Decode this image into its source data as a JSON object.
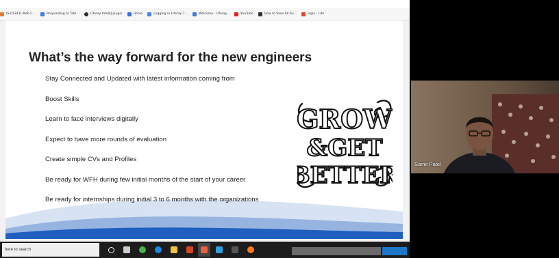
{
  "browser": {
    "bookmarks": [
      {
        "label": "IS-01343) Web C...",
        "color": "#e07b39"
      },
      {
        "label": "Responding to Tabl...",
        "color": "#3d7be0"
      },
      {
        "label": "Liferay IntelliJ plugin",
        "color": "#2b2b2b"
      },
      {
        "label": "Home",
        "color": "#3a6fd8"
      },
      {
        "label": "Logging in Liferay 7...",
        "color": "#4c86e6"
      },
      {
        "label": "Welcome - Liferay...",
        "color": "#3d7be0"
      },
      {
        "label": "YouTube",
        "color": "#e62117"
      },
      {
        "label": "How to View All Ru...",
        "color": "#333333"
      },
      {
        "label": "login - Life",
        "color": "#e0452a"
      }
    ]
  },
  "slide": {
    "title": "What’s the way forward for the new engineers",
    "bullets": [
      "Stay Connected and Updated with latest information coming from",
      "Boost Skills",
      "Learn to face interviews digitally",
      "Expect to have more rounds of evaluation",
      "Create simple CVs and Profiles",
      "Be ready for WFH during few initial months of the start of your career",
      "Be ready for internships during initial 3 to 6 months with the organizations"
    ],
    "art_text": [
      "GROW",
      "&GET",
      "BETTER"
    ],
    "accent_color": "#1f5fbf"
  },
  "taskbar": {
    "search_text": "here to search",
    "apps": [
      {
        "name": "cortana-icon",
        "color": "#ffffff"
      },
      {
        "name": "task-view-icon",
        "color": "#cccccc"
      },
      {
        "name": "chrome-icon",
        "color": "#4caf50"
      },
      {
        "name": "edge-icon",
        "color": "#1e88e5"
      },
      {
        "name": "file-explorer-icon",
        "color": "#f5c242"
      },
      {
        "name": "powerpoint-icon",
        "color": "#d24726"
      },
      {
        "name": "intellij-icon",
        "color": "#e8613c"
      },
      {
        "name": "vscode-icon",
        "color": "#2f9ee0"
      },
      {
        "name": "terminal-icon",
        "color": "#555555"
      },
      {
        "name": "firefox-icon",
        "color": "#ff7a1a"
      }
    ]
  },
  "participant": {
    "name": "Samir Patel"
  }
}
